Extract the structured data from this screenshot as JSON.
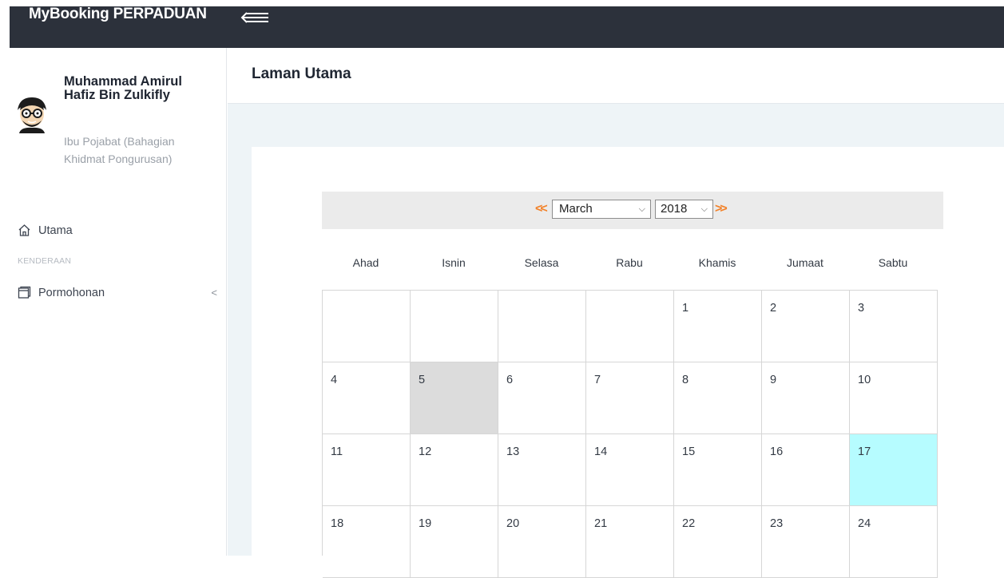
{
  "app": {
    "brand": "MyBooking PERPADUAN"
  },
  "user": {
    "name": "Muhammad Amirul Hafiz Bin Zulkifly",
    "department": "Ibu Pojabat (Bahagian Khidmat Pongurusan)"
  },
  "sidebar": {
    "home_label": "Utama",
    "section_label": "KENDERAAN",
    "permohonan_label": "Pormohonan",
    "permohonan_chevron": "<"
  },
  "page": {
    "title": "Laman Utama"
  },
  "calendar": {
    "prev_label": "<<",
    "next_label": ">>",
    "month": "March",
    "year": "2018",
    "weekdays": [
      "Ahad",
      "Isnin",
      "Selasa",
      "Rabu",
      "Khamis",
      "Jumaat",
      "Sabtu"
    ],
    "weeks": [
      [
        "",
        "",
        "",
        "",
        "1",
        "2",
        "3"
      ],
      [
        "4",
        "5",
        "6",
        "7",
        "8",
        "9",
        "10"
      ],
      [
        "11",
        "12",
        "13",
        "14",
        "15",
        "16",
        "17"
      ],
      [
        "18",
        "19",
        "20",
        "21",
        "22",
        "23",
        "24"
      ]
    ],
    "highlight_grey_day": "5",
    "highlight_today_day": "17",
    "colors": {
      "accent_arrows": "#f2822a",
      "today": "#b6fcff",
      "grey_day": "#dcdcdc",
      "topbar": "#2c313b"
    }
  }
}
